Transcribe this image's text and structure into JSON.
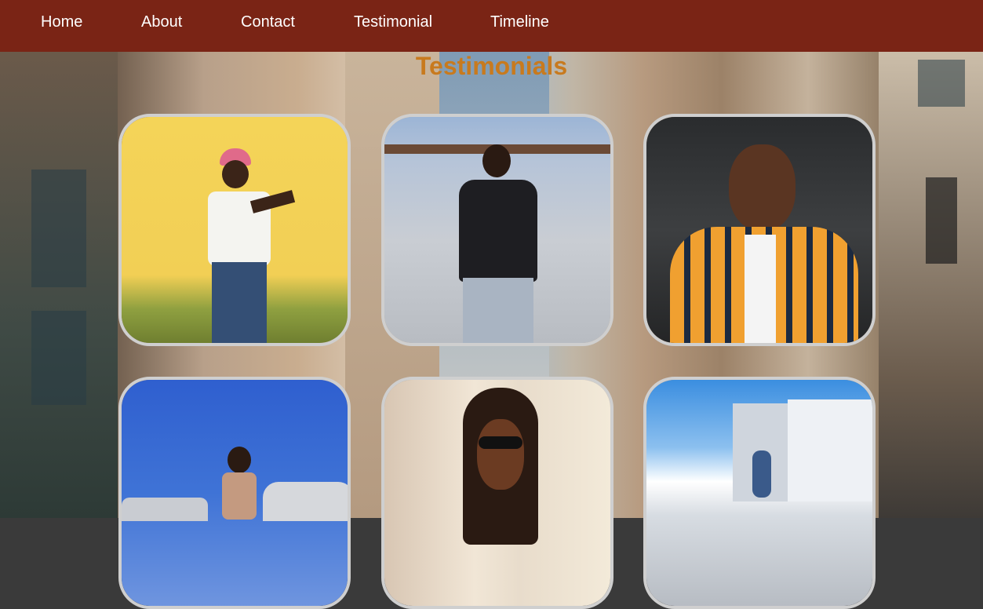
{
  "nav": {
    "items": [
      "Home",
      "About",
      "Contact",
      "Testimonial",
      "Timeline"
    ]
  },
  "page_title": "Testimonials",
  "colors": {
    "nav_bg": "#7a2415",
    "title": "#c87a1e",
    "card_border": "#cfcfcf"
  },
  "testimonials": [
    {
      "photo": "man-pink-cap-yellow-wall"
    },
    {
      "photo": "man-black-sweater-arms-crossed"
    },
    {
      "photo": "man-plaid-shirt-smiling"
    },
    {
      "photo": "woman-blue-sky-cars"
    },
    {
      "photo": "woman-sunglasses-braids"
    },
    {
      "photo": "man-street-buildings"
    }
  ]
}
